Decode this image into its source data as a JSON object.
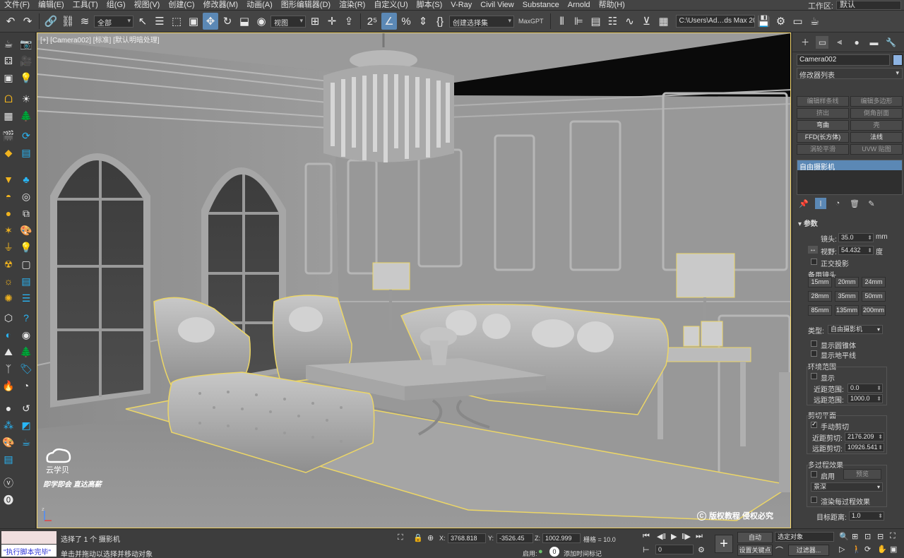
{
  "menu": [
    "文件(F)",
    "编辑(E)",
    "工具(T)",
    "组(G)",
    "视图(V)",
    "创建(C)",
    "修改器(M)",
    "动画(A)",
    "图形编辑器(D)",
    "渲染(R)",
    "自定义(U)",
    "脚本(S)",
    "V-Ray",
    "Civil View",
    "Substance",
    "Arnold",
    "帮助(H)"
  ],
  "workspace": {
    "label": "工作区:",
    "value": "默认"
  },
  "toolbar": {
    "selection_filter": "全部",
    "ref_coord": "视图",
    "named_selection": "创建选择集",
    "maxgpt": "MaxGPT",
    "path": "C:\\Users\\Ad…ds Max 2024"
  },
  "viewport": {
    "label": "[+] [Camera002] [标准] [默认明暗处理]",
    "watermark_brand": "云学贝",
    "watermark_slogan": "即学即会 直达高薪",
    "watermark_copy": "版权教程 侵权必究",
    "accent": "#f1d36a"
  },
  "command_panel": {
    "object_name": "Camera002",
    "modifier_list": "修改器列表",
    "modifier_buttons": [
      {
        "label": "编辑样条线",
        "enabled": false
      },
      {
        "label": "编辑多边形",
        "enabled": false
      },
      {
        "label": "挤出",
        "enabled": false
      },
      {
        "label": "倒角剖面",
        "enabled": false
      },
      {
        "label": "弯曲",
        "enabled": true
      },
      {
        "label": "壳",
        "enabled": false
      },
      {
        "label": "FFD(长方体)",
        "enabled": true
      },
      {
        "label": "法线",
        "enabled": true
      },
      {
        "label": "涡轮平滑",
        "enabled": false
      },
      {
        "label": "UVW 贴图",
        "enabled": false
      }
    ],
    "stack_item": "自由摄影机",
    "params": {
      "rollout": "参数",
      "lens_label": "镜头:",
      "lens_value": "35.0",
      "lens_unit": "mm",
      "fov_label": "视野:",
      "fov_value": "54.432",
      "fov_unit": "度",
      "ortho": "正交投影",
      "stock_lenses_label": "备用镜头",
      "stock_lenses": [
        "15mm",
        "20mm",
        "24mm",
        "28mm",
        "35mm",
        "50mm",
        "85mm",
        "135mm",
        "200mm"
      ],
      "type_label": "类型:",
      "type_value": "自由摄影机",
      "show_cone": "显示圆锥体",
      "show_horizon": "显示地平线",
      "env_range": "环境范围",
      "show": "显示",
      "near_range_label": "近距范围:",
      "near_range_value": "0.0",
      "far_range_label": "远距范围:",
      "far_range_value": "1000.0",
      "clip_planes": "剪切平面",
      "manual_clip": "手动剪切",
      "near_clip_label": "近距剪切:",
      "near_clip_value": "2176.209",
      "far_clip_label": "远距剪切:",
      "far_clip_value": "10926.541",
      "multipass": "多过程效果",
      "enable": "启用",
      "preview": "预览",
      "effect": "景深",
      "render_each_pass": "渲染每过程效果",
      "target_dist_label": "目标距离:",
      "target_dist_value": "1.0"
    }
  },
  "status": {
    "script_done": "\"执行脚本完毕\"",
    "selected": "选择了 1 个 摄影机",
    "hint": "单击并拖动以选择并移动对象",
    "x_label": "X:",
    "x_value": "3768.818",
    "y_label": "Y:",
    "y_value": "-3526.45",
    "z_label": "Z:",
    "z_value": "1002.999",
    "grid": "栅格 = 10.0",
    "enabled_label": "启用:",
    "add_time_tag": "添加时间标记",
    "auto": "自动",
    "selected_obj": "选定对象",
    "set_key": "设置关键点",
    "filters": "过滤器...",
    "frame": "0"
  }
}
